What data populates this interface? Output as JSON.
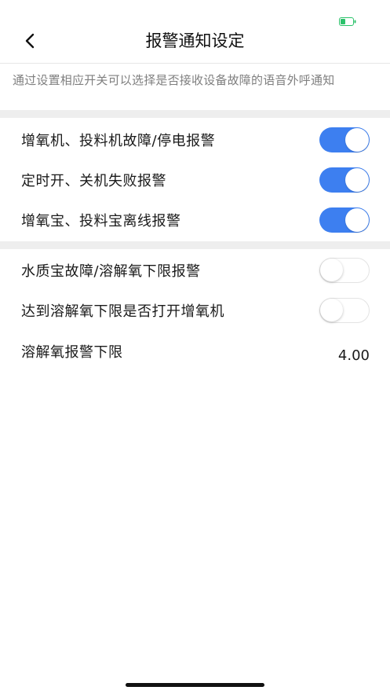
{
  "colors": {
    "accent": "#3d7ff0",
    "battery": "#2cc26b",
    "separator": "#eeeeee",
    "muted_text": "#7f7f7f"
  },
  "status_bar": {
    "battery_icon": "battery-icon"
  },
  "nav": {
    "back_icon": "chevron-left-icon",
    "title": "报警通知设定"
  },
  "description": "通过设置相应开关可以选择是否接收设备故障的语音外呼通知",
  "group1": [
    {
      "label": "增氧机、投料机故障/停电报警",
      "enabled": true
    },
    {
      "label": "定时开、关机失败报警",
      "enabled": true
    },
    {
      "label": "增氧宝、投料宝离线报警",
      "enabled": true
    }
  ],
  "group2": [
    {
      "label": "水质宝故障/溶解氧下限报警",
      "enabled": false
    },
    {
      "label": "达到溶解氧下限是否打开增氧机",
      "enabled": false
    }
  ],
  "threshold": {
    "label": "溶解氧报警下限",
    "value": "4.00"
  }
}
